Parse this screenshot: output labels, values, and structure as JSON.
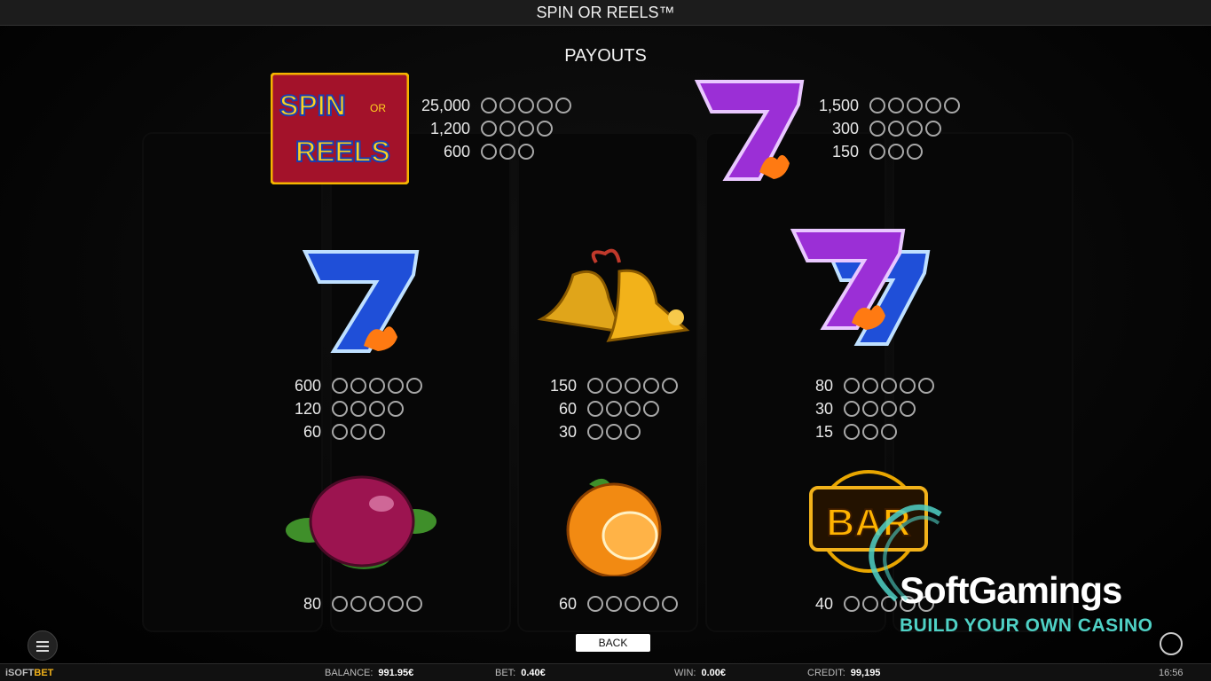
{
  "window": {
    "title": "SPIN OR REELS™"
  },
  "payouts": {
    "heading": "PAYOUTS",
    "back_label": "BACK"
  },
  "symbols": [
    {
      "name": "spin-or-reels-logo",
      "logo_text": [
        "SPIN",
        "OR",
        "REELS"
      ],
      "payouts": [
        {
          "amount": "25,000",
          "count": 5
        },
        {
          "amount": "1,200",
          "count": 4
        },
        {
          "amount": "600",
          "count": 3
        }
      ]
    },
    {
      "name": "purple-seven",
      "payouts": [
        {
          "amount": "1,500",
          "count": 5
        },
        {
          "amount": "300",
          "count": 4
        },
        {
          "amount": "150",
          "count": 3
        }
      ]
    },
    {
      "name": "blue-seven",
      "payouts": [
        {
          "amount": "600",
          "count": 5
        },
        {
          "amount": "120",
          "count": 4
        },
        {
          "amount": "60",
          "count": 3
        }
      ]
    },
    {
      "name": "golden-bells",
      "payouts": [
        {
          "amount": "150",
          "count": 5
        },
        {
          "amount": "60",
          "count": 4
        },
        {
          "amount": "30",
          "count": 3
        }
      ]
    },
    {
      "name": "double-seven",
      "payouts": [
        {
          "amount": "80",
          "count": 5
        },
        {
          "amount": "30",
          "count": 4
        },
        {
          "amount": "15",
          "count": 3
        }
      ]
    },
    {
      "name": "plum",
      "payouts": [
        {
          "amount": "80",
          "count": 5
        }
      ]
    },
    {
      "name": "orange",
      "payouts": [
        {
          "amount": "60",
          "count": 5
        }
      ]
    },
    {
      "name": "bar",
      "logo_text": [
        "BAR"
      ],
      "payouts": [
        {
          "amount": "40",
          "count": 5
        }
      ]
    }
  ],
  "footer": {
    "brand_prefix": "iSOFT",
    "brand_suffix": "BET",
    "balance_label": "BALANCE:",
    "balance_value": "991.95€",
    "bet_label": "BET:",
    "bet_value": "0.40€",
    "win_label": "WIN:",
    "win_value": "0.00€",
    "credit_label": "CREDIT:",
    "credit_value": "99,195",
    "clock": "16:56"
  },
  "watermark": {
    "name": "SoftGamings",
    "tagline": "BUILD YOUR OWN CASINO"
  },
  "colors": {
    "accent_teal": "#4fd1c5",
    "purple": "#9b2fd6",
    "blue": "#1f4fd8",
    "gold": "#f2b21a"
  }
}
